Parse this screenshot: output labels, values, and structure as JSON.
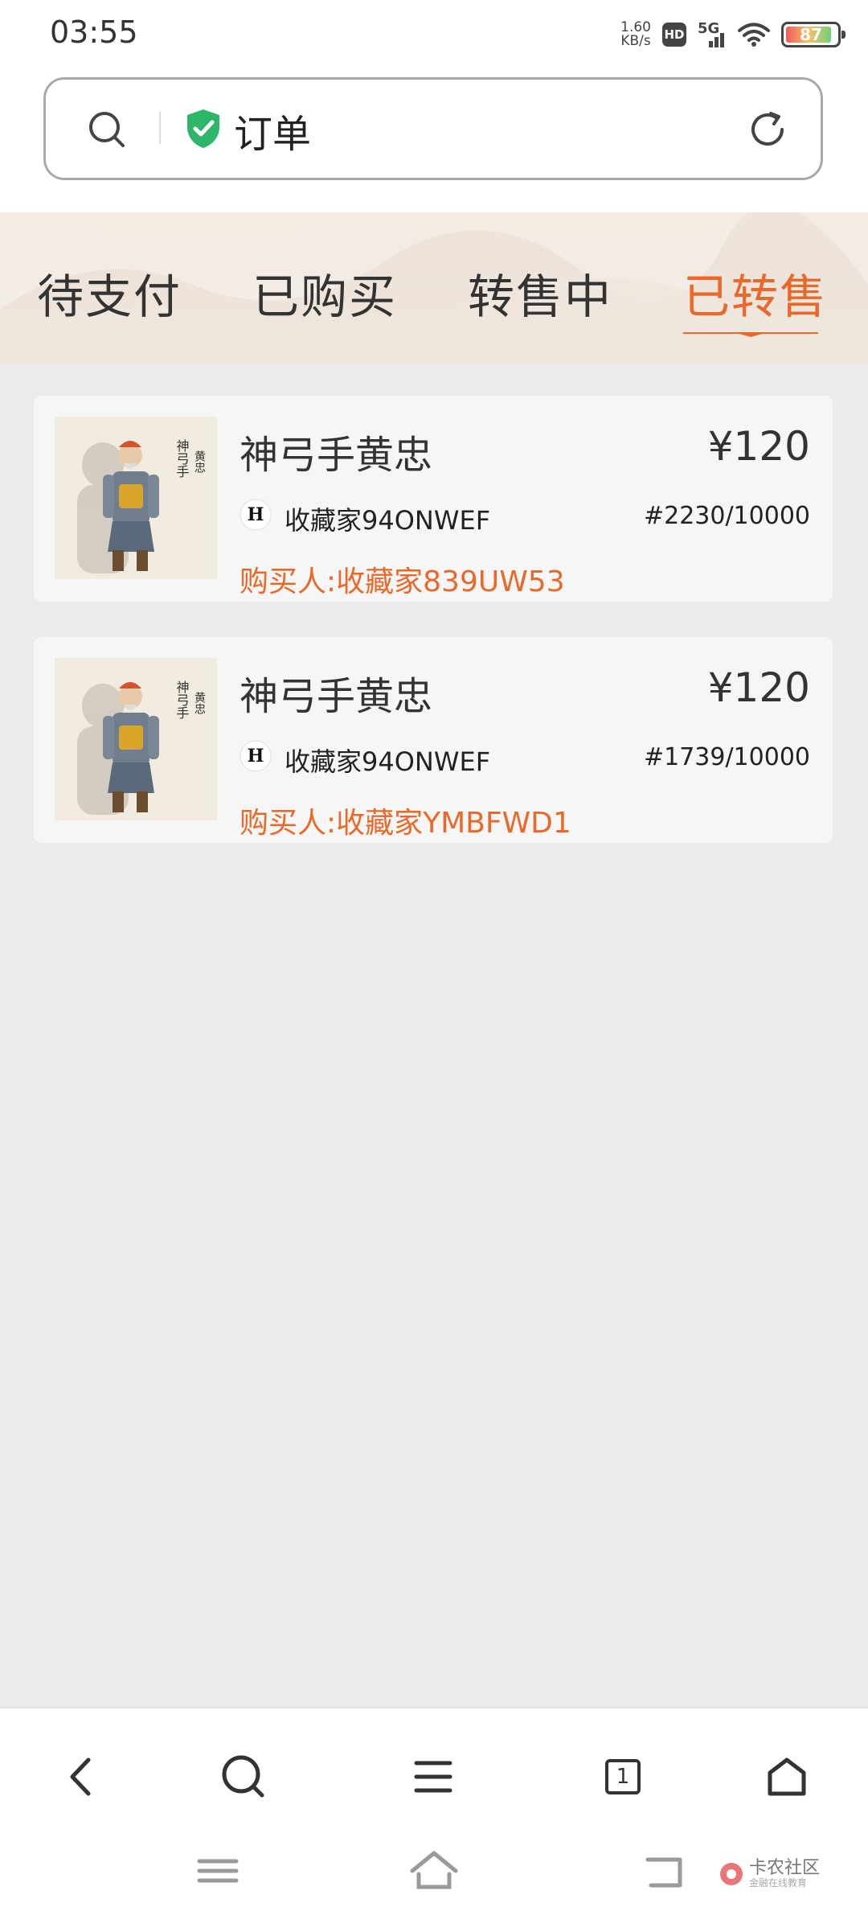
{
  "status_bar": {
    "time": "03:55",
    "net_speed_value": "1.60",
    "net_speed_unit": "KB/s",
    "hd_label": "HD",
    "network_label": "5G",
    "battery_level": "87"
  },
  "search": {
    "title": "订单"
  },
  "tabs": [
    {
      "label": "待支付"
    },
    {
      "label": "已购买"
    },
    {
      "label": "转售中"
    },
    {
      "label": "已转售"
    }
  ],
  "orders": [
    {
      "name": "神弓手黄忠",
      "price": "¥120",
      "seller": "收藏家94ONWEF",
      "serial": "#2230/10000",
      "buyer": "购买人:收藏家839UW53"
    },
    {
      "name": "神弓手黄忠",
      "price": "¥120",
      "seller": "收藏家94ONWEF",
      "serial": "#1739/10000",
      "buyer": "购买人:收藏家YMBFWD1"
    }
  ],
  "nav": {
    "tab_count": "1"
  },
  "watermark": {
    "text": "卡农社区",
    "sub": "金融在线教育"
  },
  "colors": {
    "accent": "#e8692a",
    "background": "#ebebeb",
    "card": "#f6f6f6"
  }
}
